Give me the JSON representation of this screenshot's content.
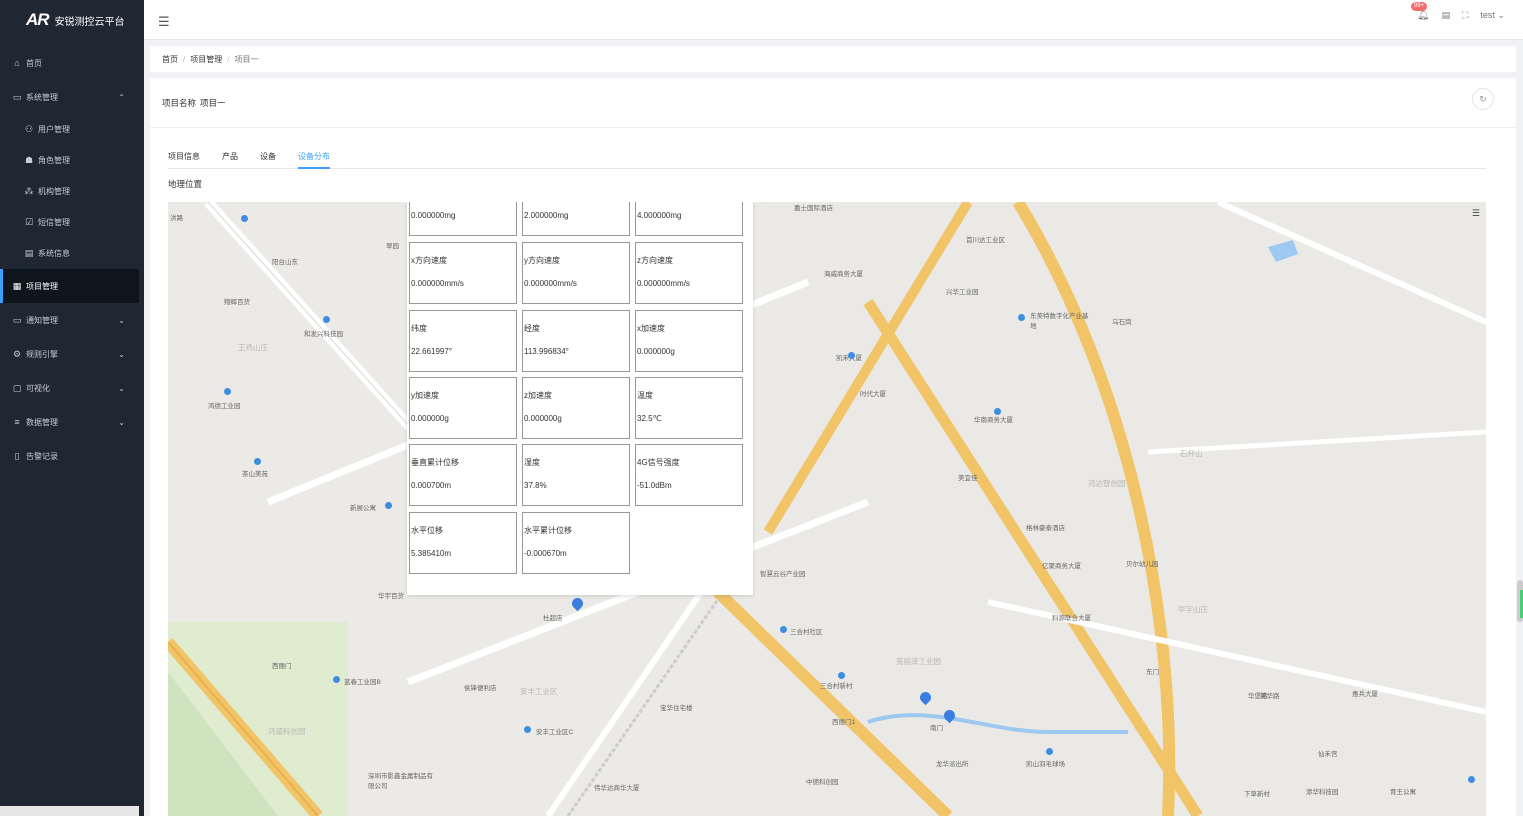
{
  "app": {
    "name": "安锐测控云平台",
    "logo_text": "AR"
  },
  "sidebar": {
    "items": [
      {
        "label": "首页",
        "icon": "home-icon"
      },
      {
        "label": "系统管理",
        "icon": "monitor-icon",
        "arrow": "⌃"
      },
      {
        "label": "用户管理",
        "icon": "users-icon"
      },
      {
        "label": "角色管理",
        "icon": "role-icon"
      },
      {
        "label": "机构管理",
        "icon": "org-icon"
      },
      {
        "label": "短信管理",
        "icon": "sms-icon"
      },
      {
        "label": "系统信息",
        "icon": "info-icon"
      },
      {
        "label": "项目管理",
        "icon": "project-icon"
      },
      {
        "label": "通知管理",
        "icon": "notice-icon",
        "arrow": "⌄"
      },
      {
        "label": "规则引擎",
        "icon": "rule-icon",
        "arrow": "⌄"
      },
      {
        "label": "可视化",
        "icon": "visual-icon",
        "arrow": "⌄"
      },
      {
        "label": "数据管理",
        "icon": "data-icon",
        "arrow": "⌄"
      },
      {
        "label": "告警记录",
        "icon": "alarm-icon"
      }
    ]
  },
  "topbar": {
    "badge": "99+",
    "user": "test"
  },
  "breadcrumb": {
    "home": "首页",
    "parent": "项目管理",
    "current": "项目一"
  },
  "project": {
    "label": "项目名称",
    "name": "项目一"
  },
  "tabs": [
    {
      "label": "项目信息"
    },
    {
      "label": "产品"
    },
    {
      "label": "设备"
    },
    {
      "label": "设备分布"
    }
  ],
  "geo_label": "地理位置",
  "popup": {
    "cells": [
      {
        "label": "",
        "value": "0.000000mg"
      },
      {
        "label": "",
        "value": "2.000000mg"
      },
      {
        "label": "",
        "value": "4.000000mg"
      },
      {
        "label": "x方向速度",
        "value": "0.000000mm/s"
      },
      {
        "label": "y方向速度",
        "value": "0.000000mm/s"
      },
      {
        "label": "z方向速度",
        "value": "0.000000mm/s"
      },
      {
        "label": "纬度",
        "value": "22.661997°"
      },
      {
        "label": "经度",
        "value": "113.996834°"
      },
      {
        "label": "x加速度",
        "value": "0.000000g"
      },
      {
        "label": "y加速度",
        "value": "0.000000g"
      },
      {
        "label": "z加速度",
        "value": "0.000000g"
      },
      {
        "label": "温度",
        "value": "32.5℃"
      },
      {
        "label": "垂直累计位移",
        "value": "0.000700m"
      },
      {
        "label": "湿度",
        "value": "37.8%"
      },
      {
        "label": "4G信号强度",
        "value": "-51.0dBm"
      },
      {
        "label": "水平位移",
        "value": "5.385410m"
      },
      {
        "label": "水平累计位移",
        "value": "-0.000670m"
      }
    ]
  },
  "map_labels": [
    {
      "text": "洪路"
    },
    {
      "text": "阳台山东"
    },
    {
      "text": "翠园"
    },
    {
      "text": "翔辉百货"
    },
    {
      "text": "和发兴科技园"
    },
    {
      "text": "王鸡山庄"
    },
    {
      "text": "鸿德工业园"
    },
    {
      "text": "茶山美苑"
    },
    {
      "text": "新展公寓"
    },
    {
      "text": "华宇百货"
    },
    {
      "text": "西丽门"
    },
    {
      "text": "蓝春工业园B"
    },
    {
      "text": "侯锋便利店"
    },
    {
      "text": "鸿德科创园"
    },
    {
      "text": "深圳市影鑫金属制品有限公司"
    },
    {
      "text": "杜超店"
    },
    {
      "text": "安丰工业区"
    },
    {
      "text": "安丰工业区C"
    },
    {
      "text": "宝华住宅楼"
    },
    {
      "text": "伟华达商华大厦"
    },
    {
      "text": "智慧云谷产业园"
    },
    {
      "text": "三合村社区"
    },
    {
      "text": "三合村新村"
    },
    {
      "text": "亮丽泽工业园"
    },
    {
      "text": "西丽门1"
    },
    {
      "text": "南门"
    },
    {
      "text": "龙华派出所"
    },
    {
      "text": "中德科创园"
    },
    {
      "text": "亿聚商务大厦"
    },
    {
      "text": "科源联合大厦"
    },
    {
      "text": "凯山羽毛球场"
    },
    {
      "text": "华宇山庄"
    },
    {
      "text": "东门"
    },
    {
      "text": "华堡路"
    },
    {
      "text": "惠兵大厦"
    },
    {
      "text": "仙禾宫"
    },
    {
      "text": "添华科技园"
    },
    {
      "text": "育王公寓"
    },
    {
      "text": "下草新村"
    },
    {
      "text": "嘉士国际酒店"
    },
    {
      "text": "首川达工业区"
    },
    {
      "text": "兴华工业园"
    },
    {
      "text": "海威商务大厦"
    },
    {
      "text": "凯禾大厦"
    },
    {
      "text": "时代大厦"
    },
    {
      "text": "东美特数字化产业基地"
    },
    {
      "text": "乌石岗"
    },
    {
      "text": "华南商务大厦"
    },
    {
      "text": "鸿达智创园"
    },
    {
      "text": "美宜佳"
    },
    {
      "text": "格林豪泰酒店"
    },
    {
      "text": "贝尔幼儿园"
    },
    {
      "text": "美华路"
    },
    {
      "text": "石杯山"
    }
  ]
}
